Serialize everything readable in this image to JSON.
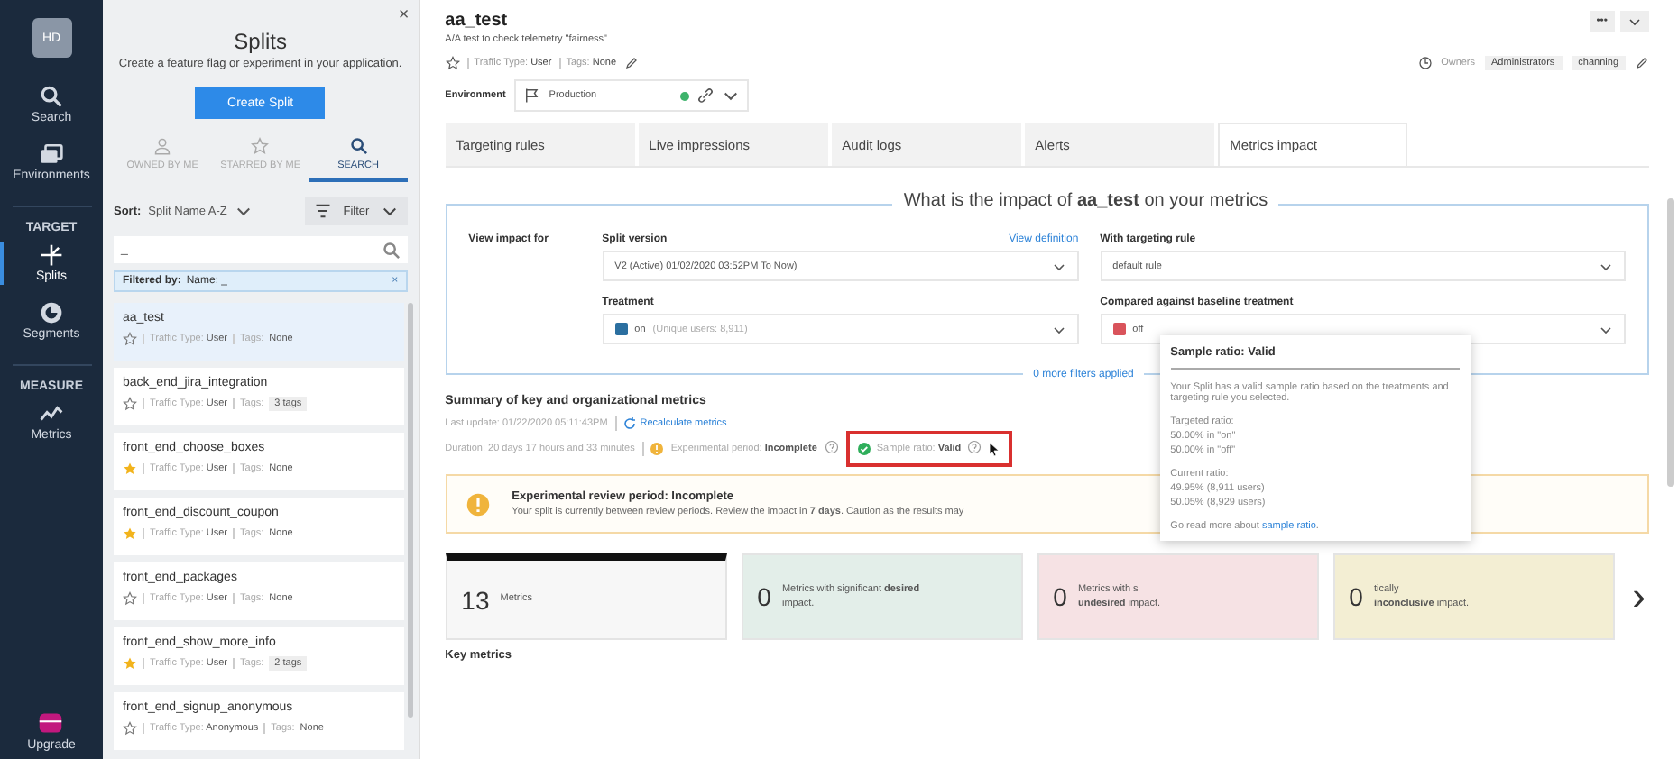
{
  "nav": {
    "avatar": "HD",
    "items": [
      {
        "kind": "item",
        "label": "Search",
        "selected": false
      },
      {
        "kind": "item",
        "label": "Environments",
        "selected": false
      },
      {
        "kind": "section",
        "label": "TARGET"
      },
      {
        "kind": "item",
        "label": "Splits",
        "selected": true
      },
      {
        "kind": "item",
        "label": "Segments",
        "selected": false
      },
      {
        "kind": "section",
        "label": "MEASURE"
      },
      {
        "kind": "item",
        "label": "Metrics",
        "selected": false
      }
    ],
    "upgrade": "Upgrade"
  },
  "splits_panel": {
    "close": "×",
    "title": "Splits",
    "subtitle": "Create a feature flag or experiment in your application.",
    "create_button": "Create Split",
    "tabs": [
      {
        "label": "OWNED BY ME",
        "selected": false
      },
      {
        "label": "STARRED BY ME",
        "selected": false
      },
      {
        "label": "SEARCH",
        "selected": true
      }
    ],
    "sort_label": "Sort:",
    "sort_value": "Split Name A-Z",
    "filter_button": "Filter",
    "search_value": "_",
    "filtered_by": {
      "label": "Filtered by:",
      "value": "Name: _",
      "clear": "×"
    },
    "items": [
      {
        "kind": "plain",
        "name": "aa_test",
        "starred": false,
        "traffic_label": "Traffic Type:",
        "traffic_type": "User",
        "tags_label": "Tags:",
        "tags": "None",
        "selected": true
      },
      {
        "kind": "chip",
        "name": "back_end_jira_integration",
        "starred": false,
        "traffic_label": "Traffic Type:",
        "traffic_type": "User",
        "tags_label": "Tags:",
        "tags": "3 tags",
        "selected": false
      },
      {
        "kind": "plain",
        "name": "front_end_choose_boxes",
        "starred": true,
        "traffic_label": "Traffic Type:",
        "traffic_type": "User",
        "tags_label": "Tags:",
        "tags": "None",
        "selected": false
      },
      {
        "kind": "plain",
        "name": "front_end_discount_coupon",
        "starred": true,
        "traffic_label": "Traffic Type:",
        "traffic_type": "User",
        "tags_label": "Tags:",
        "tags": "None",
        "selected": false
      },
      {
        "kind": "plain",
        "name": "front_end_packages",
        "starred": false,
        "traffic_label": "Traffic Type:",
        "traffic_type": "User",
        "tags_label": "Tags:",
        "tags": "None",
        "selected": false
      },
      {
        "kind": "chip",
        "name": "front_end_show_more_info",
        "starred": true,
        "traffic_label": "Traffic Type:",
        "traffic_type": "User",
        "tags_label": "Tags:",
        "tags": "2 tags",
        "selected": false
      },
      {
        "kind": "plain",
        "name": "front_end_signup_anonymous",
        "starred": false,
        "traffic_label": "Traffic Type:",
        "traffic_type": "Anonymous",
        "tags_label": "Tags:",
        "tags": "None",
        "selected": false
      }
    ]
  },
  "split": {
    "name": "aa_test",
    "description": "A/A test to check telemetry \"fairness\"",
    "starred": false,
    "traffic_label": "Traffic Type:",
    "traffic_type": "User",
    "tags_label": "Tags:",
    "tags": "None",
    "owners_label": "Owners",
    "owners": [
      "Administrators",
      "channing"
    ],
    "more_button": "•••",
    "environment_label": "Environment",
    "environment": "Production"
  },
  "tabs": [
    {
      "label": "Targeting rules",
      "selected": false
    },
    {
      "label": "Live impressions",
      "selected": false
    },
    {
      "label": "Audit logs",
      "selected": false
    },
    {
      "label": "Alerts",
      "selected": false
    },
    {
      "label": "Metrics impact",
      "selected": true
    }
  ],
  "impact": {
    "legend": "What is the impact of **aa_test** on your metrics",
    "view_for": "View impact for",
    "split_version_label": "Split version",
    "view_definition": "View definition",
    "split_version": "V2 (Active) 01/02/2020 03:52PM To Now)",
    "rule_label": "With targeting rule",
    "rule": "default rule",
    "treatment_label": "Treatment",
    "treatment": "on",
    "treatment_detail": "(Unique users: 8,911)",
    "baseline_label": "Compared against baseline treatment",
    "baseline": "off",
    "more_filters": "0 more filters applied"
  },
  "summary": {
    "title": "Summary of key and organizational metrics",
    "last_update": "Last update: 01/22/2020 05:11:43PM",
    "recalculate": "Recalculate metrics",
    "duration": "Duration: 20 days 17 hours and 33 minutes",
    "experimental": "Experimental period: **Incomplete**",
    "sample_ratio": "Sample ratio: **Valid**",
    "sample_ratio_highlighted": true
  },
  "alert": {
    "title": "Experimental review period: Incomplete",
    "text": "Your split is currently between review periods. Review the impact in **7 days**. Caution as the results may"
  },
  "metric_cards": [
    {
      "kind": "total",
      "count": "13",
      "line1": "Metrics",
      "selected": true
    },
    {
      "kind": "desired",
      "count": "0",
      "line1": "Metrics with significant **desired**",
      "line2": "impact.",
      "selected": false
    },
    {
      "kind": "undesired",
      "count": "0",
      "line1": "Metrics with s",
      "line2": "**undesired** impact.",
      "selected": false
    },
    {
      "kind": "inconclusive",
      "count": "0",
      "line1": "tically",
      "line2": "**inconclusive** impact.",
      "selected": false
    }
  ],
  "next_button": "›",
  "key_metrics": "Key metrics",
  "tooltip": {
    "title": "Sample ratio: Valid",
    "text": "Your Split has a valid sample ratio based on the treatments and targeting rule you selected.",
    "targeted_label": "Targeted ratio:",
    "targeted": [
      "50.00% in \"on\"",
      "50.00% in \"off\""
    ],
    "current_label": "Current ratio:",
    "current": [
      "49.95% (8,911 users)",
      "50.05% (8,929 users)"
    ],
    "more_prefix": "Go read more about",
    "more_link": "sample ratio",
    "more_suffix": "."
  }
}
